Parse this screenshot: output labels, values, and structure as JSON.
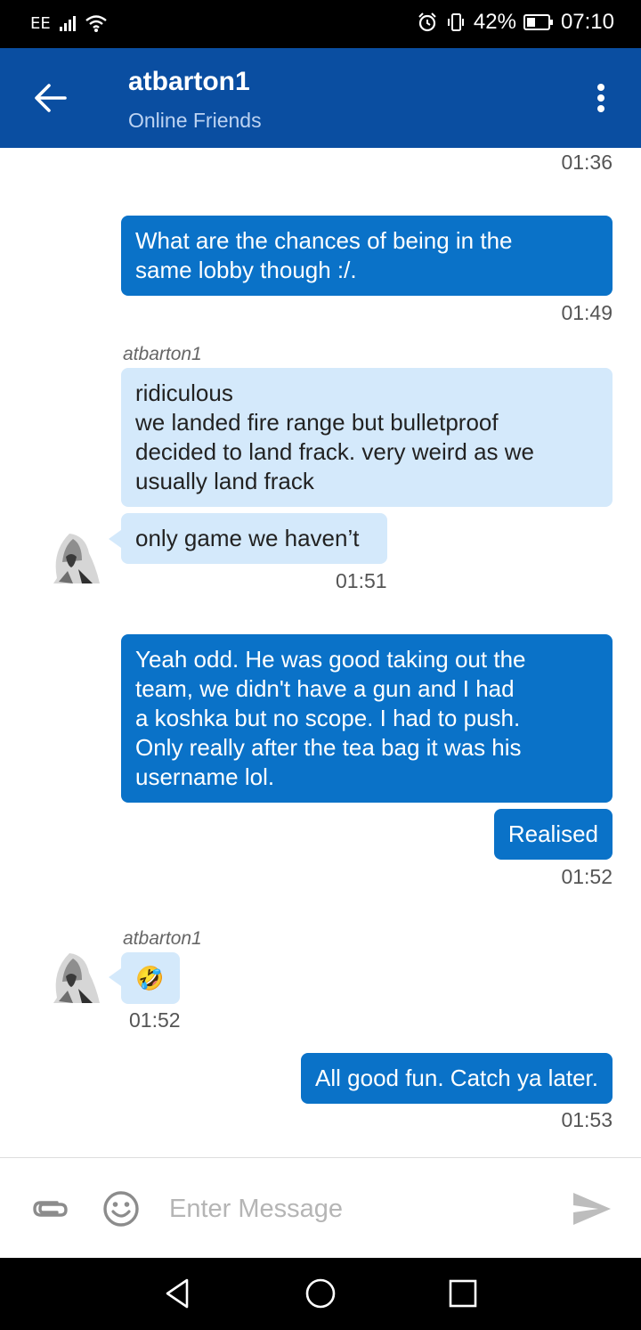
{
  "status_bar": {
    "carrier": "EE",
    "battery_level": 0.42,
    "battery_text": "42%",
    "time": "07:10"
  },
  "header": {
    "title": "atbarton1",
    "subtitle": "Online Friends",
    "back_icon": "arrow-left-icon",
    "menu_icon": "more-vertical-icon",
    "color": "#0a4ea1"
  },
  "chat": {
    "top_timestamp": "01:36",
    "m1": {
      "text": "What are the chances of being in the\nsame lobby though :/.",
      "time": "01:49"
    },
    "g1": {
      "sender": "atbarton1",
      "b1": "ridiculous\nwe landed fire range but bulletproof\ndecided to land frack. very weird as we\nusually land frack",
      "b2": "only game we haven’t",
      "time": "01:51"
    },
    "m2": {
      "text": "Yeah odd. He was good taking out the\nteam, we didn't have a gun and I had\na koshka but no scope. I had to push.\nOnly really after the tea bag it was his\nusername lol."
    },
    "m3": {
      "text": "Realised",
      "time": "01:52"
    },
    "g2": {
      "sender": "atbarton1",
      "emoji": "🤣",
      "time": "01:52"
    },
    "m4": {
      "text": "All good fun. Catch ya later.",
      "time": "01:53"
    },
    "outgoing_color": "#0a72c8",
    "incoming_color": "#d4e9fb"
  },
  "composer": {
    "placeholder": "Enter Message",
    "value": "",
    "attach_icon": "paperclip-icon",
    "emoji_icon": "smiley-icon",
    "send_icon": "send-icon"
  },
  "nav_bar": {
    "icons": [
      "back-triangle-icon",
      "home-circle-icon",
      "recents-square-icon"
    ]
  }
}
